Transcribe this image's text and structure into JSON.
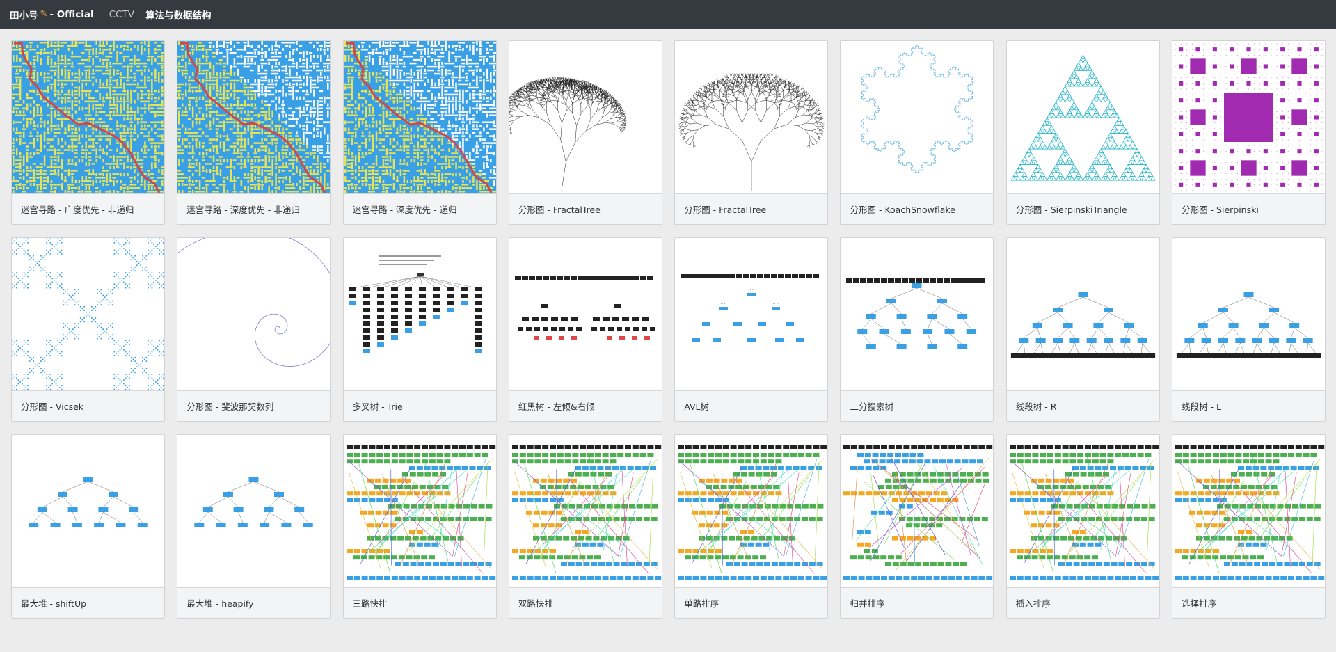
{
  "navbar": {
    "brand_name": "田小号",
    "brand_suffix": "- Official",
    "links": [
      "CCTV",
      "算法与数据结构"
    ]
  },
  "cards": [
    {
      "caption": "迷宫寻路 - 广度优先 - 非递归",
      "icon": "maze-yellow"
    },
    {
      "caption": "迷宫寻路 - 深度优先 - 非递归",
      "icon": "maze-mixed"
    },
    {
      "caption": "迷宫寻路 - 深度优先 - 递归",
      "icon": "maze-mixed2"
    },
    {
      "caption": "分形图 - FractalTree",
      "icon": "fractal-tree-lean"
    },
    {
      "caption": "分形图 - FractalTree",
      "icon": "fractal-tree-sym"
    },
    {
      "caption": "分形图 - KoachSnowflake",
      "icon": "koch-snowflake"
    },
    {
      "caption": "分形图 - SierpinskiTriangle",
      "icon": "sierpinski-triangle"
    },
    {
      "caption": "分形图 - Sierpinski",
      "icon": "sierpinski-carpet"
    },
    {
      "caption": "分形图 - Vicsek",
      "icon": "vicsek"
    },
    {
      "caption": "分形图 - 斐波那契数列",
      "icon": "fibonacci-spiral"
    },
    {
      "caption": "多叉树 - Trie",
      "icon": "trie"
    },
    {
      "caption": "红黑树 - 左倾&右倾",
      "icon": "rb-tree"
    },
    {
      "caption": "AVL树",
      "icon": "avl-tree"
    },
    {
      "caption": "二分搜索树",
      "icon": "bst"
    },
    {
      "caption": "线段树 - R",
      "icon": "segment-tree-r"
    },
    {
      "caption": "线段树 - L",
      "icon": "segment-tree-l"
    },
    {
      "caption": "最大堆 - shiftUp",
      "icon": "heap"
    },
    {
      "caption": "最大堆 - heapify",
      "icon": "heap2"
    },
    {
      "caption": "三路快排",
      "icon": "sort-quick3"
    },
    {
      "caption": "双路快排",
      "icon": "sort-quick2"
    },
    {
      "caption": "单路排序",
      "icon": "sort-quick1"
    },
    {
      "caption": "归并排序",
      "icon": "sort-merge"
    },
    {
      "caption": "插入排序",
      "icon": "sort-insert"
    },
    {
      "caption": "选择排序",
      "icon": "sort-select"
    }
  ],
  "colors": {
    "navbar_bg": "#343a40",
    "maze_blue": "#3aa0e6",
    "maze_yellow": "#e8e45a",
    "maze_path": "#d04848",
    "sierpinski_cyan": "#21b5c8",
    "carpet_purple": "#a02ab0",
    "node_blue": "#3aa0e6",
    "node_green": "#4caf50",
    "node_orange": "#f5a623"
  }
}
